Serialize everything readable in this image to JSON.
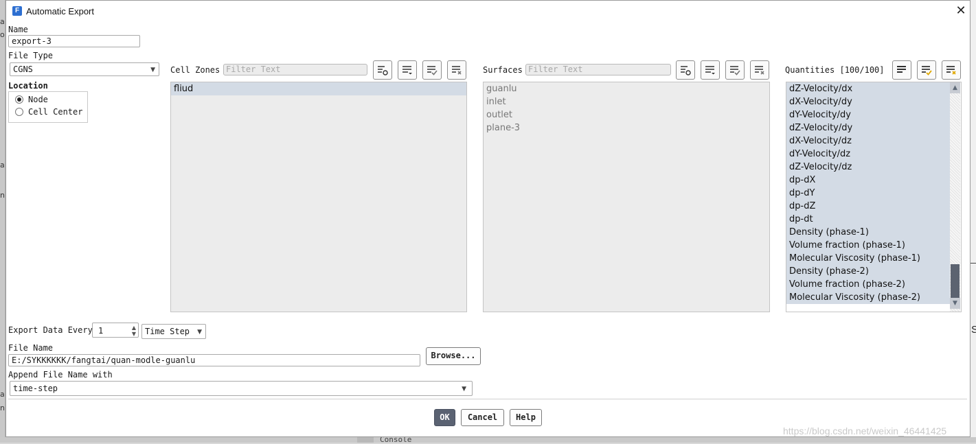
{
  "window": {
    "title": "Automatic Export",
    "icon_letter": "F"
  },
  "name": {
    "label": "Name",
    "value": "export-3"
  },
  "file_type": {
    "label": "File Type",
    "value": "CGNS"
  },
  "location": {
    "label": "Location",
    "options": [
      "Node",
      "Cell Center"
    ],
    "selected": "Node"
  },
  "cell_zones": {
    "label": "Cell Zones",
    "filter_placeholder": "Filter Text",
    "items": [
      "fliud"
    ],
    "selected": [
      "fliud"
    ]
  },
  "surfaces": {
    "label": "Surfaces",
    "filter_placeholder": "Filter Text",
    "items": [
      "guanlu",
      "inlet",
      "outlet",
      "plane-3"
    ]
  },
  "quantities": {
    "label": "Quantities [100/100]",
    "items": [
      "dZ-Velocity/dx",
      "dX-Velocity/dy",
      "dY-Velocity/dy",
      "dZ-Velocity/dy",
      "dX-Velocity/dz",
      "dY-Velocity/dz",
      "dZ-Velocity/dz",
      "dp-dX",
      "dp-dY",
      "dp-dZ",
      "dp-dt",
      "Density (phase-1)",
      "Volume fraction (phase-1)",
      "Molecular Viscosity (phase-1)",
      "Density (phase-2)",
      "Volume fraction (phase-2)",
      "Molecular Viscosity (phase-2)"
    ]
  },
  "export_every": {
    "label": "Export Data Every",
    "value": "1",
    "unit": "Time Step"
  },
  "file_name": {
    "label": "File Name",
    "value": "E:/SYKKKKKK/fangtai/quan-modle-guanlu",
    "browse_label": "Browse..."
  },
  "append": {
    "label": "Append File Name with",
    "value": "time-step"
  },
  "buttons": {
    "ok": "OK",
    "cancel": "Cancel",
    "help": "Help"
  },
  "background": {
    "console_label": "Console",
    "right_fragment": "S"
  },
  "watermark": "https://blog.csdn.net/weixin_46441425",
  "icons": {
    "toolbar": [
      "select-by-name-icon",
      "sort-icon",
      "select-all-icon",
      "deselect-all-icon"
    ],
    "dropdown": "chevron-down-icon",
    "spinner": [
      "spin-up-icon",
      "spin-down-icon"
    ]
  },
  "colors": {
    "selection": "#d3dbe5",
    "primary_button": "#5a6272",
    "list_bg": "#ececec",
    "scroll_thumb": "#5c6370"
  }
}
